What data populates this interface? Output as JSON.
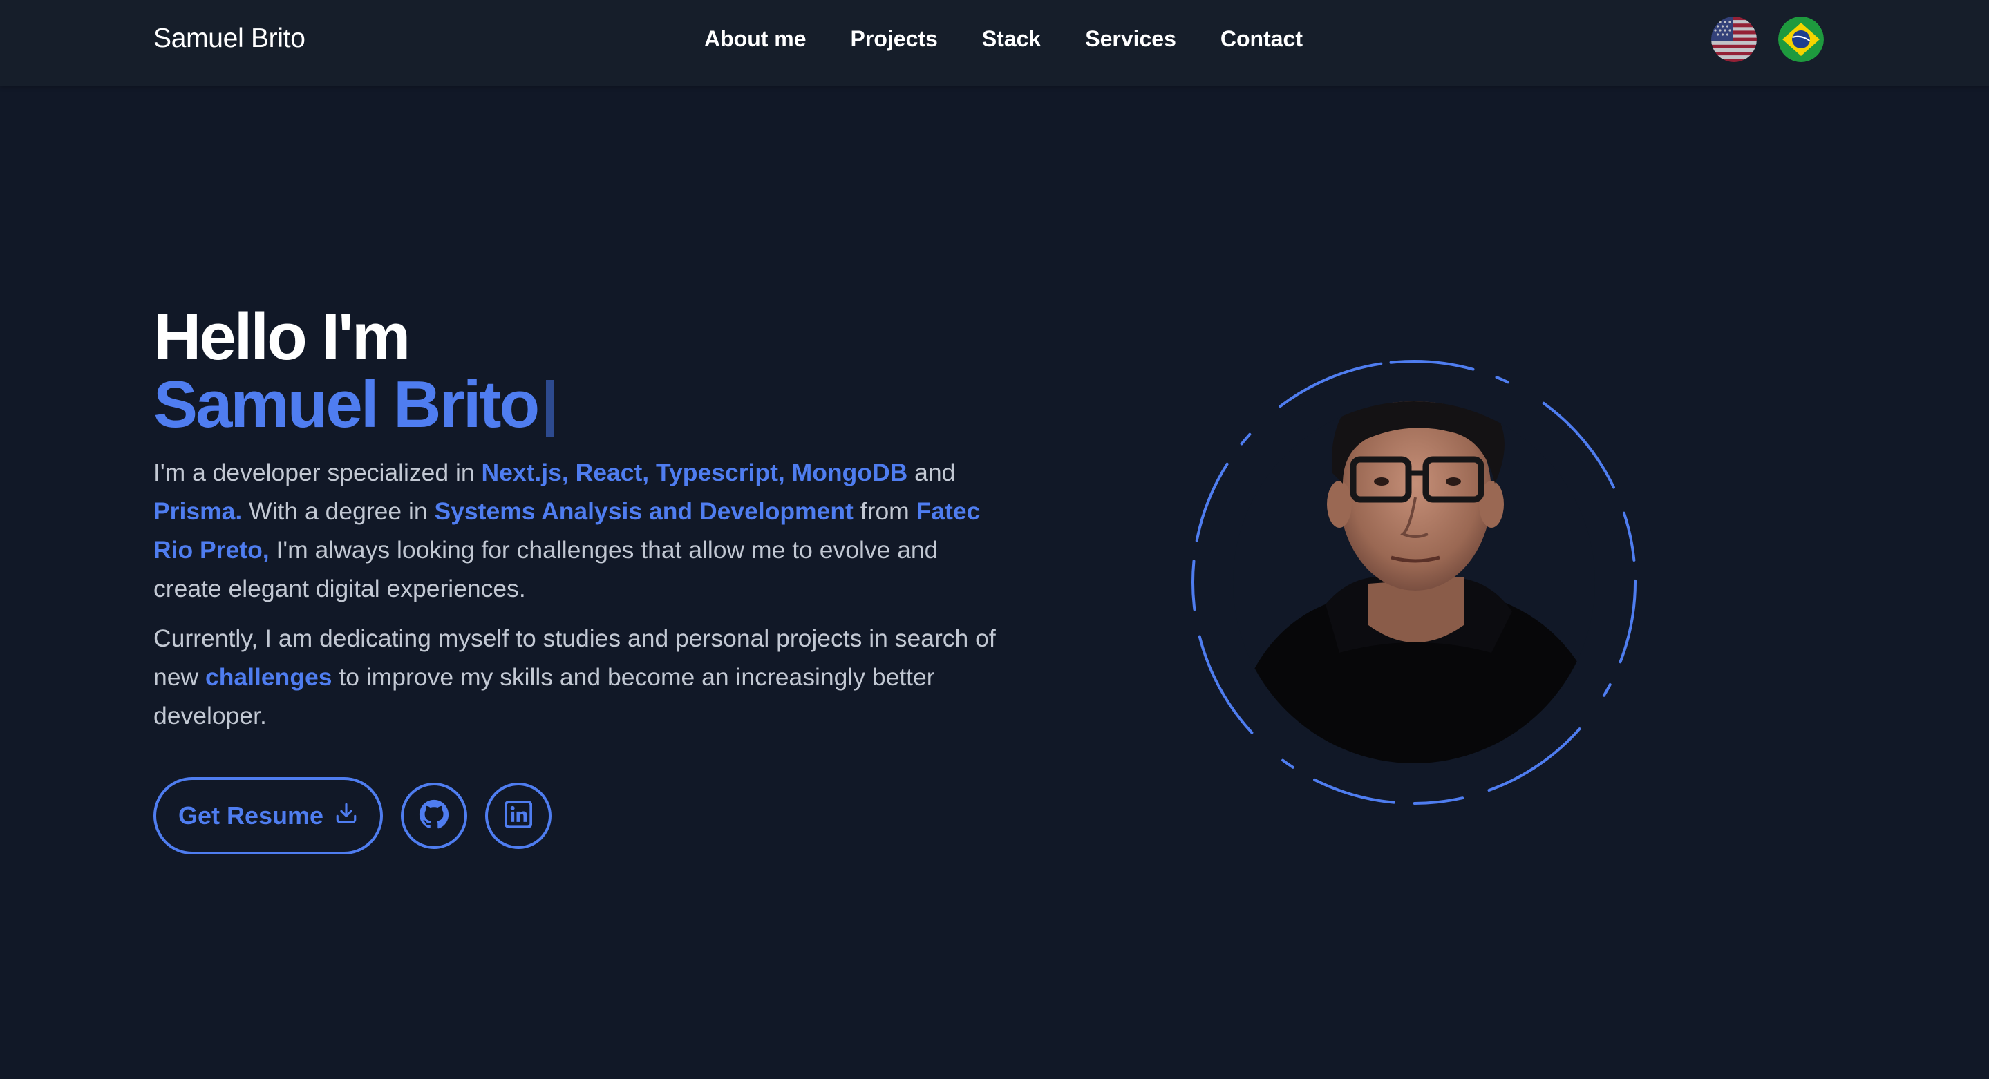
{
  "header": {
    "brand": "Samuel Brito",
    "nav": [
      {
        "label": "About me"
      },
      {
        "label": "Projects"
      },
      {
        "label": "Stack"
      },
      {
        "label": "Services"
      },
      {
        "label": "Contact"
      }
    ],
    "languages": [
      {
        "icon": "us-flag-icon"
      },
      {
        "icon": "brazil-flag-icon"
      }
    ]
  },
  "hero": {
    "greeting": "Hello I'm",
    "name": "Samuel Brito",
    "intro": {
      "t1": "I'm a developer specialized in ",
      "h1": "Next.js, React, Typescript, MongoDB",
      "t2": " and ",
      "h2": "Prisma.",
      "t3": " With a degree in ",
      "h3": "Systems Analysis and Development",
      "t4": " from ",
      "h4": "Fatec Rio Preto,",
      "t5": " I'm always looking for challenges that allow me to evolve and create elegant digital experiences."
    },
    "current": {
      "t1": "Currently, I am dedicating myself to studies and personal projects in search of new ",
      "h1": "challenges",
      "t2": " to improve my skills and become an increasingly better developer."
    },
    "buttons": {
      "resume_label": "Get Resume",
      "resume_icon": "download-icon",
      "github_icon": "github-icon",
      "linkedin_icon": "linkedin-icon"
    }
  },
  "colors": {
    "background": "#111827",
    "header": "#161e2a",
    "accent": "#4f7df0",
    "text": "#c2c8d3"
  }
}
